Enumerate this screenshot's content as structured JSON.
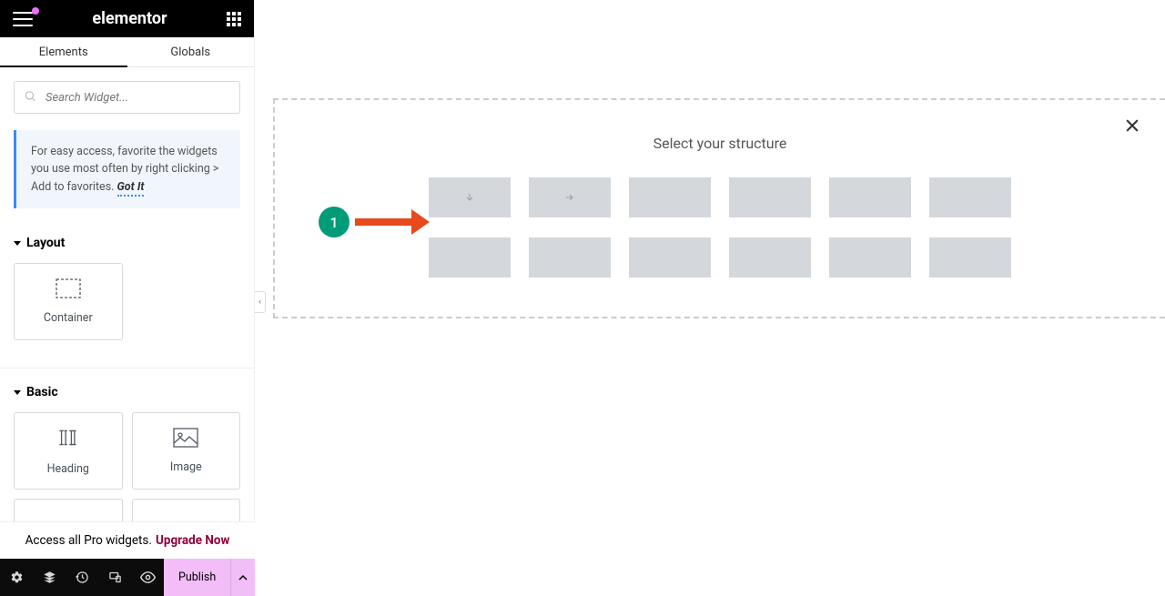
{
  "header": {
    "logo": "elementor"
  },
  "tabs": {
    "elements": "Elements",
    "globals": "Globals"
  },
  "search": {
    "placeholder": "Search Widget..."
  },
  "notice": {
    "text": "For easy access, favorite the widgets you use most often by right clicking > Add to favorites.",
    "gotit": "Got It"
  },
  "sections": {
    "layout": "Layout",
    "basic": "Basic"
  },
  "widgets": {
    "container": "Container",
    "heading": "Heading",
    "image": "Image"
  },
  "upgrade": {
    "text": "Access all Pro widgets.",
    "cta": "Upgrade Now"
  },
  "footer": {
    "publish": "Publish"
  },
  "canvas": {
    "title": "Select your structure"
  },
  "annotation": {
    "step": "1"
  }
}
